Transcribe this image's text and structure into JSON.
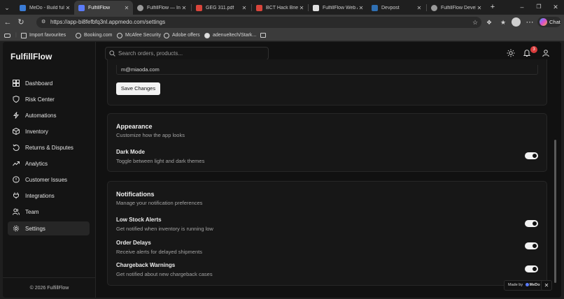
{
  "browser": {
    "tabs": [
      {
        "label": "MeDo - Build full-s",
        "color": "#3a7bd5"
      },
      {
        "label": "FulfillFlow",
        "color": "#5b7cfa",
        "active": true
      },
      {
        "label": "FulfillFlow — Inven",
        "color": "#9a9a9a"
      },
      {
        "label": "GEG 311.pdf",
        "color": "#d9453b"
      },
      {
        "label": "BCT Hack Brief.pdf",
        "color": "#d9453b"
      },
      {
        "label": "FulfillFlow Web Ap",
        "color": "#e0e0e0"
      },
      {
        "label": "Devpost",
        "color": "#2f6fb2"
      },
      {
        "label": "FulfillFlow Develo",
        "color": "#9a9a9a"
      }
    ],
    "url": "https://app-bi8fefbfq3nl.appmedo.com/settings",
    "chat_label": "Chat",
    "bookmarks": [
      "Import favourites",
      "Booking.com",
      "McAfee Security",
      "Adobe offers",
      "adenueltech/Stark..."
    ]
  },
  "app": {
    "brand": "FulfillFlow",
    "sidebar": [
      {
        "label": "Dashboard",
        "icon": "dashboard-icon"
      },
      {
        "label": "Risk Center",
        "icon": "shield-icon"
      },
      {
        "label": "Automations",
        "icon": "bolt-icon"
      },
      {
        "label": "Inventory",
        "icon": "package-icon"
      },
      {
        "label": "Returns & Disputes",
        "icon": "rotate-icon"
      },
      {
        "label": "Analytics",
        "icon": "trend-icon"
      },
      {
        "label": "Customer Issues",
        "icon": "alert-icon"
      },
      {
        "label": "Integrations",
        "icon": "plug-icon"
      },
      {
        "label": "Team",
        "icon": "users-icon"
      },
      {
        "label": "Settings",
        "icon": "gear-icon",
        "selected": true
      }
    ],
    "footer": "© 2026 FulfillFlow",
    "search_placeholder": "Search orders, products...",
    "notification_count": "3"
  },
  "account": {
    "email": "m@miaoda.com",
    "save_label": "Save Changes"
  },
  "appearance": {
    "title": "Appearance",
    "subtitle": "Customize how the app looks",
    "dark_mode_label": "Dark Mode",
    "dark_mode_desc": "Toggle between light and dark themes",
    "dark_mode_on": true
  },
  "notifications": {
    "title": "Notifications",
    "subtitle": "Manage your notification preferences",
    "items": [
      {
        "label": "Low Stock Alerts",
        "desc": "Get notified when inventory is running low",
        "on": true
      },
      {
        "label": "Order Delays",
        "desc": "Receive alerts for delayed shipments",
        "on": true
      },
      {
        "label": "Chargeback Warnings",
        "desc": "Get notified about new chargeback cases",
        "on": true
      }
    ]
  },
  "made_by": {
    "label": "Made by",
    "brand": "MeDo"
  }
}
